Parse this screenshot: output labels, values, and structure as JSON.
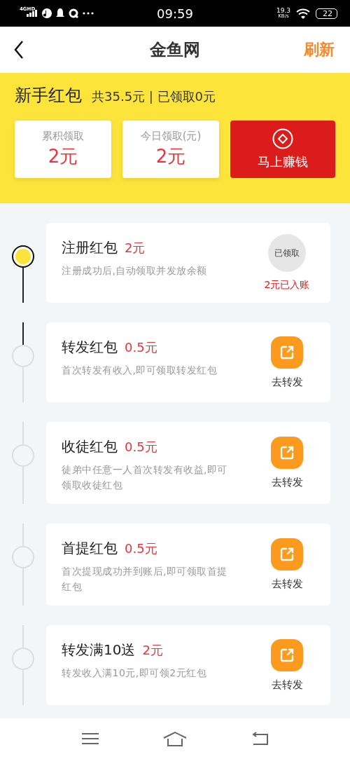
{
  "status_bar": {
    "network": "4GHD",
    "time": "09:59",
    "speed": "19.3",
    "speed_unit": "KB/s",
    "battery": "22"
  },
  "nav": {
    "title": "金鱼网",
    "action": "刷新"
  },
  "summary": {
    "title": "新手红包",
    "detail": "共35.5元 | 已领取0元"
  },
  "stats": [
    {
      "label": "累积领取",
      "value": "2元"
    },
    {
      "label": "今日领取(元)",
      "value": "2元"
    }
  ],
  "earn_button": {
    "label": "马上赚钱"
  },
  "tasks": [
    {
      "title": "注册红包",
      "amount": "2元",
      "description": "注册成功后,自动领取并发放余额",
      "done": true,
      "action": {
        "kind": "claimed",
        "badge": "已领取",
        "note": "2元已入账"
      }
    },
    {
      "title": "转发红包",
      "amount": "0.5元",
      "description": "首次转发有收入,即可领取转发红包",
      "done": false,
      "action": {
        "kind": "share",
        "label": "去转发"
      }
    },
    {
      "title": "收徒红包",
      "amount": "0.5元",
      "description": "徒弟中任意一人首次转发有收益,即可领取收徒红包",
      "done": false,
      "action": {
        "kind": "share",
        "label": "去转发"
      }
    },
    {
      "title": "首提红包",
      "amount": "0.5元",
      "description": "首次提现成功并到账后,即可领取首提红包",
      "done": false,
      "action": {
        "kind": "share",
        "label": "去转发"
      }
    },
    {
      "title": "转发满10送",
      "amount": "2元",
      "description": "转发收入满10元,即可领2元红包",
      "done": false,
      "action": {
        "kind": "share",
        "label": "去转发"
      }
    }
  ]
}
